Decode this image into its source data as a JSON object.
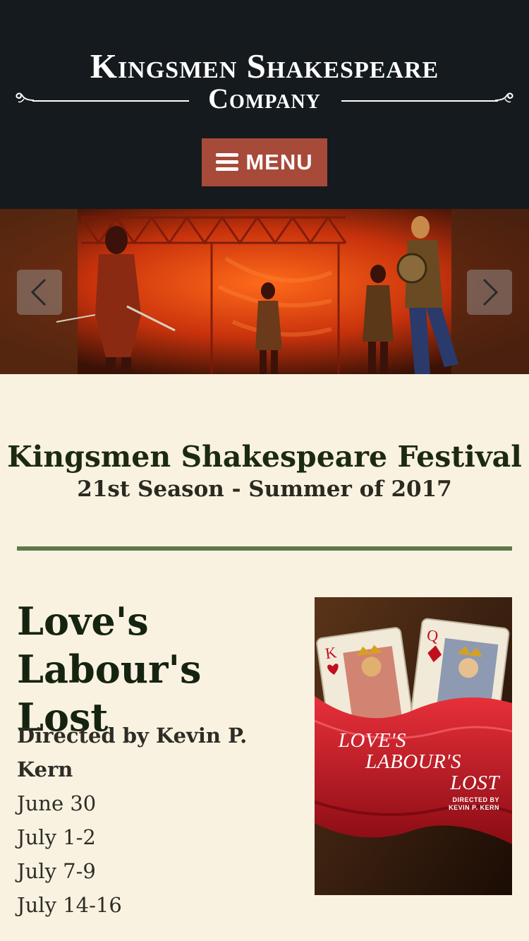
{
  "header": {
    "logo_line1": "Kingsmen Shakespeare",
    "logo_line2": "Company",
    "menu_label": "MENU",
    "background": "#151a1e",
    "menu_color": "#a84a39"
  },
  "hero": {
    "prev_icon": "chevron-left-icon",
    "next_icon": "chevron-right-icon"
  },
  "festival": {
    "title": "Kingsmen Shakespeare Festival",
    "subtitle": "21st Season - Summer of 2017",
    "divider_color": "#5d7a4a"
  },
  "play": {
    "title": "Love's Labour's Lost",
    "director": "Directed by Kevin P. Kern",
    "dates": [
      "June 30",
      "July 1-2",
      "July 7-9",
      "July 14-16"
    ],
    "poster": {
      "title_line1": "LOVE'S",
      "title_line2": "LABOUR'S",
      "title_line3": "LOST",
      "credit_line1": "DIRECTED BY",
      "credit_line2": "KEVIN P. KERN"
    }
  }
}
